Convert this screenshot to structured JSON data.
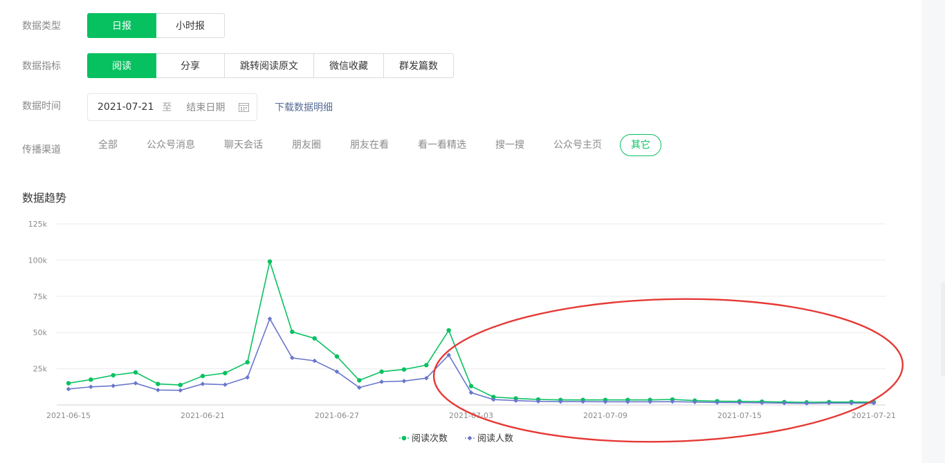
{
  "filters": {
    "data_type": {
      "label": "数据类型",
      "options": [
        "日报",
        "小时报"
      ],
      "selected": "日报"
    },
    "metric": {
      "label": "数据指标",
      "options": [
        "阅读",
        "分享",
        "跳转阅读原文",
        "微信收藏",
        "群发篇数"
      ],
      "selected": "阅读"
    },
    "time": {
      "label": "数据时间",
      "start": "2021-07-21",
      "separator": "至",
      "end_placeholder": "结束日期",
      "download_link": "下载数据明细"
    },
    "channel": {
      "label": "传播渠道",
      "options": [
        "全部",
        "公众号消息",
        "聊天会话",
        "朋友圈",
        "朋友在看",
        "看一看精选",
        "搜一搜",
        "公众号主页",
        "其它"
      ],
      "selected": "其它"
    }
  },
  "trend": {
    "title": "数据趋势"
  },
  "colors": {
    "accent": "#07c160",
    "series_reads": "#07c160",
    "series_readers": "#6a76cc",
    "annotation": "#e53935"
  },
  "chart_data": {
    "type": "line",
    "x": [
      "2021-06-15",
      "2021-06-16",
      "2021-06-17",
      "2021-06-18",
      "2021-06-19",
      "2021-06-20",
      "2021-06-21",
      "2021-06-22",
      "2021-06-23",
      "2021-06-24",
      "2021-06-25",
      "2021-06-26",
      "2021-06-27",
      "2021-06-28",
      "2021-06-29",
      "2021-06-30",
      "2021-07-01",
      "2021-07-02",
      "2021-07-03",
      "2021-07-04",
      "2021-07-05",
      "2021-07-06",
      "2021-07-07",
      "2021-07-08",
      "2021-07-09",
      "2021-07-10",
      "2021-07-11",
      "2021-07-12",
      "2021-07-13",
      "2021-07-14",
      "2021-07-15",
      "2021-07-16",
      "2021-07-17",
      "2021-07-18",
      "2021-07-19",
      "2021-07-20",
      "2021-07-21"
    ],
    "x_tick_labels": [
      "2021-06-15",
      "2021-06-21",
      "2021-06-27",
      "2021-07-03",
      "2021-07-09",
      "2021-07-15",
      "2021-07-21"
    ],
    "y_tick_labels": [
      "25k",
      "50k",
      "75k",
      "100k",
      "125k"
    ],
    "ylim": [
      0,
      125000
    ],
    "grid": true,
    "legend_position": "bottom-center",
    "series": [
      {
        "name": "阅读次数",
        "values": [
          15000,
          17500,
          20500,
          22500,
          14500,
          13800,
          20000,
          22000,
          29500,
          99000,
          50500,
          46000,
          33500,
          17000,
          23000,
          24500,
          27500,
          51500,
          13000,
          5500,
          4500,
          3800,
          3500,
          3500,
          3500,
          3500,
          3500,
          3800,
          3000,
          2600,
          2500,
          2300,
          2000,
          1800,
          2000,
          2000,
          2000
        ]
      },
      {
        "name": "阅读人数",
        "values": [
          11000,
          12500,
          13200,
          15000,
          10300,
          10100,
          14500,
          14000,
          19000,
          59500,
          32500,
          30500,
          23000,
          12000,
          16000,
          16500,
          18500,
          34500,
          8500,
          3700,
          3000,
          2500,
          2300,
          2300,
          2200,
          2200,
          2200,
          2300,
          2000,
          1700,
          1600,
          1500,
          1300,
          1100,
          1300,
          1300,
          1300
        ]
      }
    ]
  }
}
